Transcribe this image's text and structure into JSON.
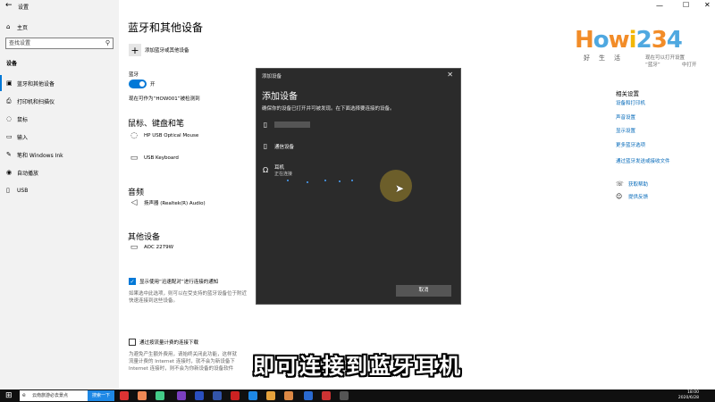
{
  "window": {
    "title": "设置"
  },
  "sidebar": {
    "home": "主页",
    "search_placeholder": "查找设置",
    "section": "设备",
    "items": [
      {
        "label": "蓝牙和其他设备",
        "icon": "bluetooth-icon"
      },
      {
        "label": "打印机和扫描仪",
        "icon": "printer-icon"
      },
      {
        "label": "鼠标",
        "icon": "mouse-icon"
      },
      {
        "label": "输入",
        "icon": "keyboard-icon"
      },
      {
        "label": "笔和 Windows Ink",
        "icon": "pen-icon"
      },
      {
        "label": "自动播放",
        "icon": "autoplay-icon"
      },
      {
        "label": "USB",
        "icon": "usb-icon"
      }
    ]
  },
  "main": {
    "title": "蓝牙和其他设备",
    "add_device": "添加蓝牙或其他设备",
    "bluetooth_label": "蓝牙",
    "bluetooth_state": "开",
    "discoverable": "现在可作为“HOW001”被检测到",
    "mouse_section": "鼠标、键盘和笔",
    "mouse_devices": [
      "HP USB Optical Mouse",
      "USB Keyboard"
    ],
    "audio_section": "音频",
    "audio_devices": [
      "扬声器 (Realtek(R) Audio)"
    ],
    "other_section": "其他设备",
    "other_devices": [
      "AOC 2279W"
    ],
    "swift_pair_label": "显示使用“迅速配对”进行连接的通知",
    "swift_pair_desc_1": "如果选中此选项，则可以在受支持的蓝牙设备位于附近",
    "swift_pair_desc_2": "快速连接到这些设备。",
    "metered_label": "通过按流量计费的连接下载",
    "metered_desc_1": "为避免产生额外费用，请始终关闭此功能，这样就",
    "metered_desc_2": "流量计费的 Internet 连接时，就不会为新设备下",
    "metered_desc_3": "Internet 连接时，则不会为你新设备的设备软件"
  },
  "right_panel": {
    "partial_1": "现在可以打开设置",
    "partial_2": "“蓝牙”",
    "partial_3": "中打开",
    "related_title": "相关设置",
    "links": [
      "设备和打印机",
      "声音设置",
      "显示设置",
      "更多蓝牙选项",
      "通过蓝牙发送或接收文件"
    ],
    "help": "获取帮助",
    "feedback": "提供反馈"
  },
  "dialog": {
    "title": "添加设备",
    "heading": "添加设备",
    "description": "确保你的设备已打开并可被发现。在下面选择要连接的设备。",
    "devices": [
      {
        "label": "",
        "icon": "phone-icon"
      },
      {
        "label": "通信设备",
        "icon": "phone-icon"
      },
      {
        "label": "耳机",
        "status": "正在连接",
        "icon": "headphones-icon"
      }
    ],
    "cancel": "取消"
  },
  "watermark": {
    "logo": "Howi234",
    "slogan": "好生活"
  },
  "subtitle": "即可连接到蓝牙耳机",
  "taskbar": {
    "search": "云南旅游必去景点",
    "search_btn": "搜索一下",
    "time": "18:00",
    "date": "2020/6/28"
  }
}
